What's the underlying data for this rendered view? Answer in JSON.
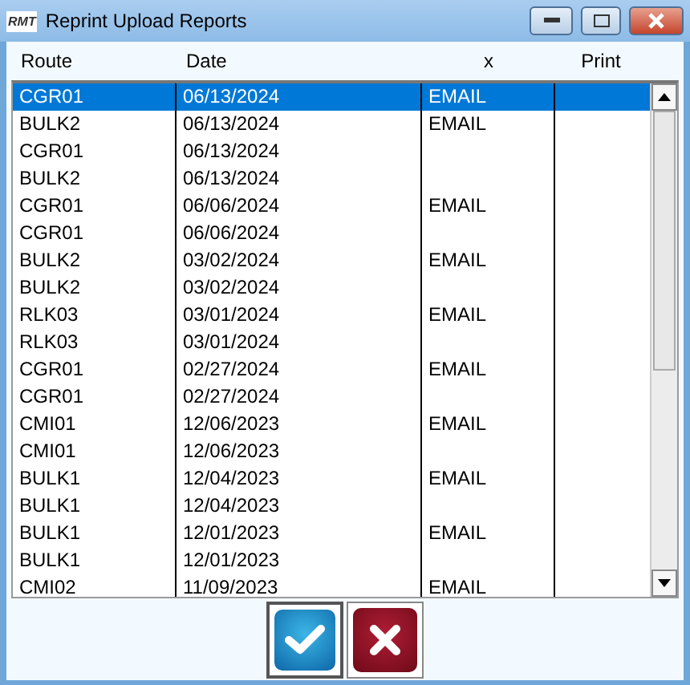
{
  "window": {
    "title": "Reprint Upload Reports",
    "logo": "RMT"
  },
  "table": {
    "columns": [
      "Route",
      "Date",
      "x",
      "Print"
    ],
    "rows": [
      {
        "route": "CGR01",
        "date": "06/13/2024",
        "x": "EMAIL",
        "selected": true
      },
      {
        "route": "BULK2",
        "date": "06/13/2024",
        "x": "EMAIL",
        "selected": false
      },
      {
        "route": "CGR01",
        "date": "06/13/2024",
        "selected": false
      },
      {
        "route": "BULK2",
        "date": "06/13/2024",
        "selected": false
      },
      {
        "route": "CGR01",
        "date": "06/06/2024",
        "x": "EMAIL",
        "selected": false
      },
      {
        "route": "CGR01",
        "date": "06/06/2024",
        "selected": false
      },
      {
        "route": "BULK2",
        "date": "03/02/2024",
        "x": "EMAIL",
        "selected": false
      },
      {
        "route": "BULK2",
        "date": "03/02/2024",
        "selected": false
      },
      {
        "route": "RLK03",
        "date": "03/01/2024",
        "x": "EMAIL",
        "selected": false
      },
      {
        "route": "RLK03",
        "date": "03/01/2024",
        "selected": false
      },
      {
        "route": "CGR01",
        "date": "02/27/2024",
        "x": "EMAIL",
        "selected": false
      },
      {
        "route": "CGR01",
        "date": "02/27/2024",
        "selected": false
      },
      {
        "route": "CMI01",
        "date": "12/06/2023",
        "x": "EMAIL",
        "selected": false
      },
      {
        "route": "CMI01",
        "date": "12/06/2023",
        "selected": false
      },
      {
        "route": "BULK1",
        "date": "12/04/2023",
        "x": "EMAIL",
        "selected": false
      },
      {
        "route": "BULK1",
        "date": "12/04/2023",
        "selected": false
      },
      {
        "route": "BULK1",
        "date": "12/01/2023",
        "x": "EMAIL",
        "selected": false
      },
      {
        "route": "BULK1",
        "date": "12/01/2023",
        "selected": false
      },
      {
        "route": "CMI02",
        "date": "11/09/2023",
        "x": "EMAIL",
        "selected": false
      }
    ]
  }
}
